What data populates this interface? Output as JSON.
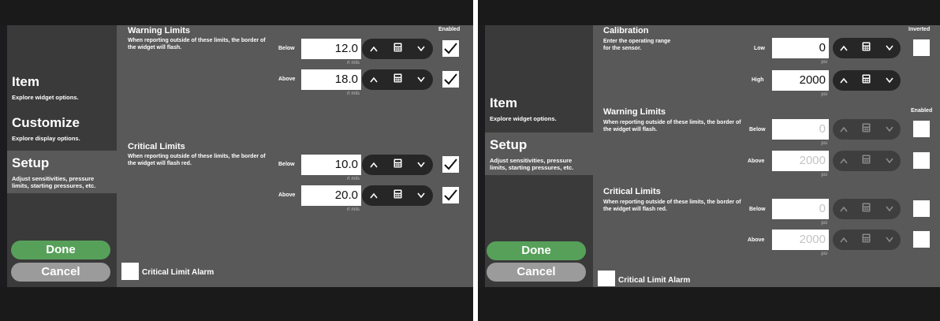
{
  "left": {
    "nav": [
      {
        "title": "Item",
        "desc": "Explore widget options."
      },
      {
        "title": "Customize",
        "desc": "Explore display options."
      },
      {
        "title": "Setup",
        "desc": "Adjust sensitivities, pressure limits, starting pressures, etc."
      }
    ],
    "done_label": "Done",
    "cancel_label": "Cancel",
    "enabled_header": "Enabled",
    "warning": {
      "title": "Warning Limits",
      "desc": "When reporting outside of these limits, the border of the widget will flash.",
      "rows": [
        {
          "label": "Below",
          "value": "12.0",
          "unit": "rt mils",
          "checked": true
        },
        {
          "label": "Above",
          "value": "18.0",
          "unit": "rt mils",
          "checked": true
        }
      ]
    },
    "critical": {
      "title": "Critical Limits",
      "desc": "When reporting outside of these limits, the border of the widget will flash red.",
      "rows": [
        {
          "label": "Below",
          "value": "10.0",
          "unit": "rt mils",
          "checked": true
        },
        {
          "label": "Above",
          "value": "20.0",
          "unit": "rt mils",
          "checked": true
        }
      ]
    },
    "alarm_label": "Critical Limit Alarm",
    "alarm_checked": false
  },
  "right": {
    "nav": [
      {
        "title": "Item",
        "desc": "Explore widget options."
      },
      {
        "title": "Setup",
        "desc": "Adjust sensitivities, pressure limits, starting pressures, etc."
      }
    ],
    "done_label": "Done",
    "cancel_label": "Cancel",
    "inverted_header": "Inverted",
    "enabled_header": "Enabled",
    "calibration": {
      "title": "Calibration",
      "desc": "Enter the operating range for the sensor.",
      "rows": [
        {
          "label": "Low",
          "value": "0",
          "unit": "psi",
          "checked": false
        },
        {
          "label": "High",
          "value": "2000",
          "unit": "psi"
        }
      ]
    },
    "warning": {
      "title": "Warning Limits",
      "desc": "When reporting outside of these limits, the border of the widget will flash.",
      "rows": [
        {
          "label": "Below",
          "value": "0",
          "unit": "psi",
          "checked": false
        },
        {
          "label": "Above",
          "value": "2000",
          "unit": "psi",
          "checked": false
        }
      ]
    },
    "critical": {
      "title": "Critical Limits",
      "desc": "When reporting outside of these limits, the border of the widget will flash red.",
      "rows": [
        {
          "label": "Below",
          "value": "0",
          "unit": "psi",
          "checked": false
        },
        {
          "label": "Above",
          "value": "2000",
          "unit": "psi",
          "checked": false
        }
      ]
    },
    "alarm_label": "Critical Limit Alarm",
    "alarm_checked": false
  },
  "colors": {
    "done": "#57a05a",
    "cancel": "#9b9b9b",
    "content": "#595959",
    "sidebar": "#3a3a3a",
    "stepper": "#262626"
  },
  "icons": {
    "up": "chevron-up-icon",
    "calc": "calculator-icon",
    "down": "chevron-down-icon",
    "check": "check-icon"
  }
}
